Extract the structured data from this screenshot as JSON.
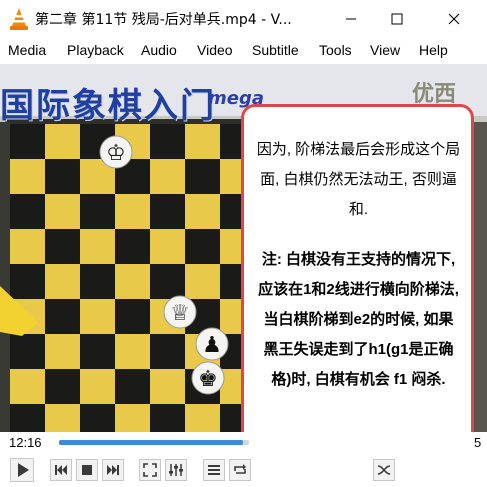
{
  "window": {
    "title": "第二章 第11节 残局-后对单兵.mp4 - V...",
    "accent_color": "#f08a0e"
  },
  "menu": {
    "items": [
      "Media",
      "Playback",
      "Audio",
      "Video",
      "Subtitle",
      "Tools",
      "View",
      "Help"
    ]
  },
  "video": {
    "banner_text": "国际象棋入门",
    "banner_logo": "mega",
    "banner_right": "优西"
  },
  "annotation": {
    "paragraph1": "因为, 阶梯法最后会形成这个局面, 白棋仍然无法动王, 否则逼和.",
    "paragraph2": "注: 白棋没有王支持的情况下, 应该在1和2线进行横向阶梯法, 当白棋阶梯到e2的时候, 如果黑王失误走到了h1(g1是正确格)时, 白棋有机会 f1 闷杀.",
    "border_color": "#e0474c"
  },
  "player": {
    "time_elapsed": "12:16",
    "time_total_fragment": "5",
    "progress": 0.97,
    "buttons": [
      "play-icon",
      "previous-icon",
      "stop-icon",
      "next-icon",
      "fullscreen-icon",
      "extended-settings-icon",
      "playlist-icon",
      "loop-icon",
      "random-icon"
    ]
  }
}
